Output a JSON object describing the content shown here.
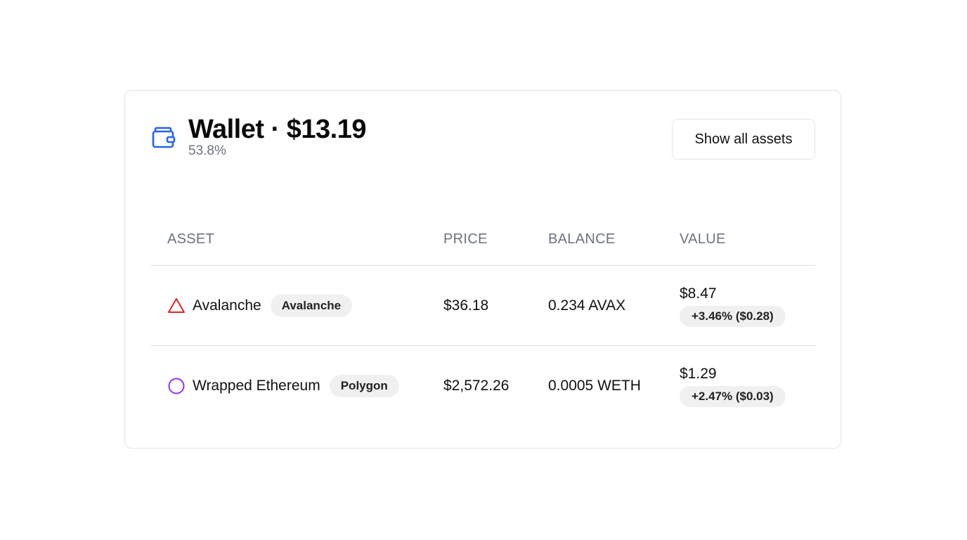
{
  "wallet": {
    "title": "Wallet · $13.19",
    "subtitle": "53.8%",
    "show_all_label": "Show all assets",
    "accent_color": "#2563eb"
  },
  "table": {
    "headers": {
      "asset": "ASSET",
      "price": "PRICE",
      "balance": "BALANCE",
      "value": "VALUE"
    },
    "rows": [
      {
        "name": "Avalanche",
        "chain": "Avalanche",
        "icon": "triangle-icon",
        "icon_color": "#dc2626",
        "price": "$36.18",
        "balance": "0.234 AVAX",
        "value": "$8.47",
        "change": "+3.46% ($0.28)"
      },
      {
        "name": "Wrapped Ethereum",
        "chain": "Polygon",
        "icon": "circle-icon",
        "icon_color": "#9333ea",
        "price": "$2,572.26",
        "balance": "0.0005 WETH",
        "value": "$1.29",
        "change": "+2.47% ($0.03)"
      }
    ]
  }
}
